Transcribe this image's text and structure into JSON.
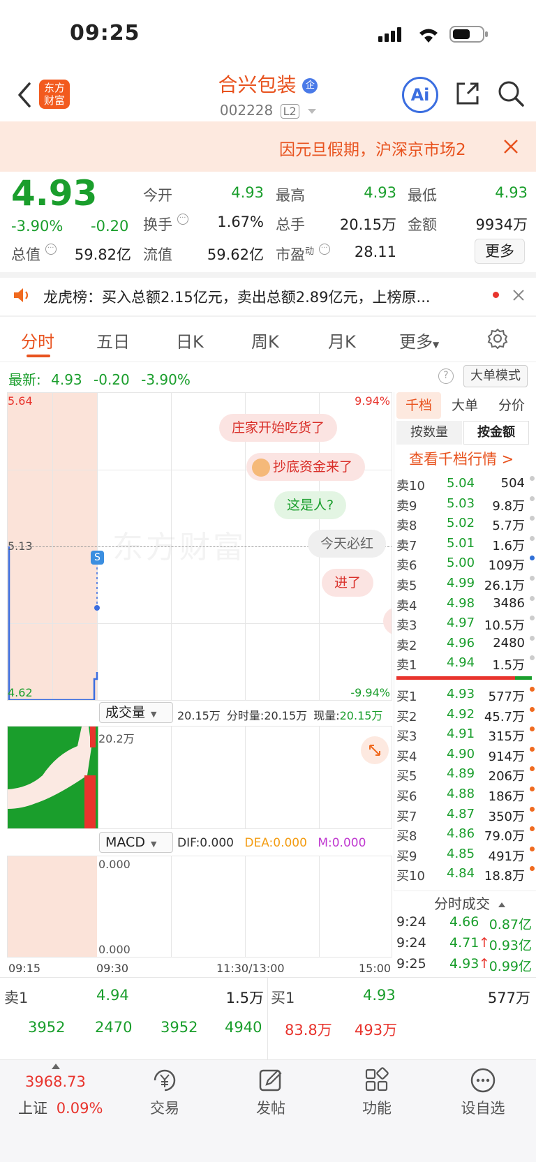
{
  "status_bar": {
    "time": "09:25"
  },
  "header": {
    "logo_text_line1": "东方",
    "logo_text_line2": "财富",
    "title": "合兴包装",
    "badge": "企",
    "code": "002228",
    "level_tag": "L2",
    "ai_label": "Ai"
  },
  "notice": {
    "text": "因元旦假期，沪深京市场2"
  },
  "quote": {
    "price": "4.93",
    "change_pct": "-3.90%",
    "change": "-0.20",
    "open_label": "今开",
    "open": "4.93",
    "high_label": "最高",
    "high": "4.93",
    "low_label": "最低",
    "low": "4.93",
    "turnover_label": "换手",
    "turnover": "1.67%",
    "volume_label": "总手",
    "volume": "20.15万",
    "amount_label": "金额",
    "amount": "9934万",
    "mktcap_label": "总值",
    "mktcap": "59.82亿",
    "float_label": "流值",
    "float_cap": "59.62亿",
    "pe_label": "市盈",
    "pe_sup": "动",
    "pe": "28.11",
    "more_button": "更多"
  },
  "dragon_tiger": {
    "text": "龙虎榜：买入总额2.15亿元，卖出总额2.89亿元，上榜原..."
  },
  "tabs": [
    "分时",
    "五日",
    "日K",
    "周K",
    "月K",
    "更多"
  ],
  "latest": {
    "label": "最新:",
    "price": "4.93",
    "change": "-0.20",
    "pct": "-3.90%",
    "mode_button": "大单模式"
  },
  "chart": {
    "y_max": "5.64",
    "y_mid": "5.13",
    "y_min": "4.62",
    "pct_max": "9.94%",
    "pct_min": "-9.94%",
    "watermark": "东方财富",
    "marker": "S",
    "bubbles": [
      "庄家开始吃货了",
      "抄底资金来了",
      "这是人?",
      "今天必红",
      "进了"
    ],
    "x_labels": [
      "09:15",
      "09:30",
      "11:30/13:00",
      "15:00"
    ]
  },
  "volume_panel": {
    "selector": "成交量",
    "total": "20.15万",
    "fenshi_label": "分时量:",
    "fenshi_value": "20.15万",
    "now_label": "现量:",
    "now_value": "20.15万",
    "axis_label": "20.2万"
  },
  "macd_panel": {
    "selector": "MACD",
    "dif": "DIF:0.000",
    "dea": "DEA:0.000",
    "m": "M:0.000",
    "top_label": "0.000",
    "bottom_label": "0.000"
  },
  "orderbook": {
    "tabs": [
      "千档",
      "大单",
      "分价"
    ],
    "subtabs": [
      "按数量",
      "按金额"
    ],
    "link": "查看千档行情 >",
    "asks": [
      {
        "label": "卖10",
        "price": "5.04",
        "vol": "504",
        "dot": "#cccccc"
      },
      {
        "label": "卖9",
        "price": "5.03",
        "vol": "9.8万",
        "dot": "#cccccc"
      },
      {
        "label": "卖8",
        "price": "5.02",
        "vol": "5.7万",
        "dot": "#cccccc"
      },
      {
        "label": "卖7",
        "price": "5.01",
        "vol": "1.6万",
        "dot": "#cccccc"
      },
      {
        "label": "卖6",
        "price": "5.00",
        "vol": "109万",
        "dot": "#2f6fd6"
      },
      {
        "label": "卖5",
        "price": "4.99",
        "vol": "26.1万",
        "dot": "#cccccc"
      },
      {
        "label": "卖4",
        "price": "4.98",
        "vol": "3486",
        "dot": "#cccccc"
      },
      {
        "label": "卖3",
        "price": "4.97",
        "vol": "10.5万",
        "dot": "#cccccc"
      },
      {
        "label": "卖2",
        "price": "4.96",
        "vol": "2480",
        "dot": "#cccccc"
      },
      {
        "label": "卖1",
        "price": "4.94",
        "vol": "1.5万",
        "dot": "#cccccc"
      }
    ],
    "bids": [
      {
        "label": "买1",
        "price": "4.93",
        "vol": "577万",
        "dot": "#f06a1f"
      },
      {
        "label": "买2",
        "price": "4.92",
        "vol": "45.7万",
        "dot": "#f06a1f"
      },
      {
        "label": "买3",
        "price": "4.91",
        "vol": "315万",
        "dot": "#f06a1f"
      },
      {
        "label": "买4",
        "price": "4.90",
        "vol": "914万",
        "dot": "#f06a1f"
      },
      {
        "label": "买5",
        "price": "4.89",
        "vol": "206万",
        "dot": "#f06a1f"
      },
      {
        "label": "买6",
        "price": "4.88",
        "vol": "186万",
        "dot": "#f06a1f"
      },
      {
        "label": "买7",
        "price": "4.87",
        "vol": "350万",
        "dot": "#f06a1f"
      },
      {
        "label": "买8",
        "price": "4.86",
        "vol": "79.0万",
        "dot": "#f06a1f"
      },
      {
        "label": "买9",
        "price": "4.85",
        "vol": "491万",
        "dot": "#f06a1f"
      },
      {
        "label": "买10",
        "price": "4.84",
        "vol": "18.8万",
        "dot": "#f06a1f"
      }
    ],
    "ticks_header": "分时成交",
    "ticks": [
      {
        "time": "9:24",
        "price": "4.66",
        "arrow": "",
        "amount": "0.87亿"
      },
      {
        "time": "9:24",
        "price": "4.71",
        "arrow": "↑",
        "amount": "0.93亿"
      },
      {
        "time": "9:25",
        "price": "4.93",
        "arrow": "↑",
        "amount": "0.99亿"
      }
    ]
  },
  "bottom_quote": {
    "sell_label": "卖1",
    "sell_price": "4.94",
    "sell_vol": "1.5万",
    "buy_label": "买1",
    "buy_price": "4.93",
    "buy_vol": "577万",
    "left_nums": [
      "3952",
      "2470",
      "3952",
      "4940"
    ],
    "right_nums": [
      "83.8万",
      "493万"
    ]
  },
  "bottom_nav": {
    "index_value": "3968.73",
    "index_name": "上证",
    "index_pct": "0.09%",
    "items": [
      "交易",
      "发帖",
      "功能",
      "设自选"
    ]
  }
}
